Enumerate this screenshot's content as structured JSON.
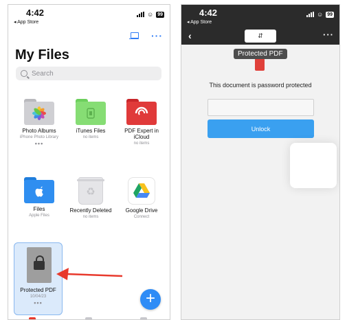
{
  "left_screen": {
    "status": {
      "time": "4:42",
      "back_app": "◂ App Store",
      "battery": "99"
    },
    "title": "My Files",
    "search": {
      "placeholder": "Search"
    },
    "locations": [
      {
        "name": "Photo Albums",
        "sub": "iPhone Photo Library",
        "more": "•••"
      },
      {
        "name": "iTunes Files",
        "sub": "no items",
        "more": ""
      },
      {
        "name": "PDF Expert in iCloud",
        "sub": "no items",
        "more": ""
      },
      {
        "name": "Files",
        "sub": "Apple Files",
        "more": ""
      },
      {
        "name": "Recently Deleted",
        "sub": "no items",
        "more": ""
      },
      {
        "name": "Google Drive",
        "sub": "Connect",
        "more": ""
      }
    ],
    "selected_file": {
      "name": "Protected PDF",
      "date": "10/04/23",
      "more": "•••"
    },
    "fab_label": "+",
    "colors": {
      "accent": "#2f7cf6",
      "arrow": "#e8392c",
      "selection": "#dbeafb"
    }
  },
  "right_screen": {
    "status": {
      "time": "4:42",
      "back_app": "◂ App Store",
      "battery": "99"
    },
    "tooltip": "Protected PDF",
    "message": "This document is password protected",
    "password": {
      "value": "",
      "placeholder": ""
    },
    "unlock_label": "Unlock",
    "colors": {
      "unlock": "#3aa0f0",
      "nav_bg": "#2b2b2b"
    }
  }
}
